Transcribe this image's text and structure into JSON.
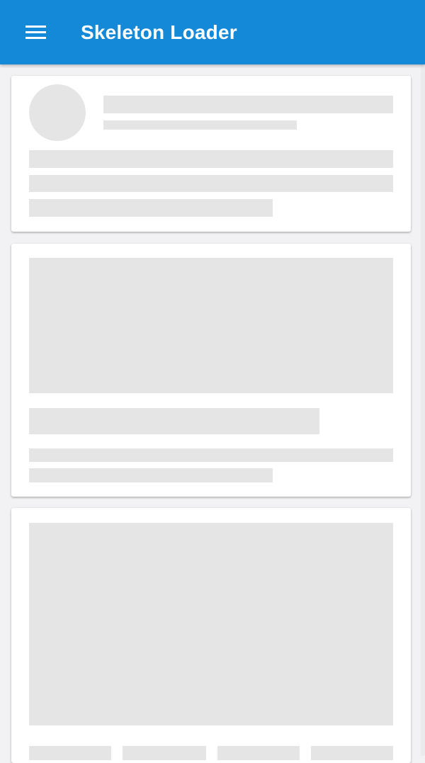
{
  "appbar": {
    "title": "Skeleton Loader",
    "menu_icon": "menu-icon",
    "color": "#1389d8"
  },
  "skeleton_color": "#e5e5e5",
  "background_color": "#f2f2f4"
}
